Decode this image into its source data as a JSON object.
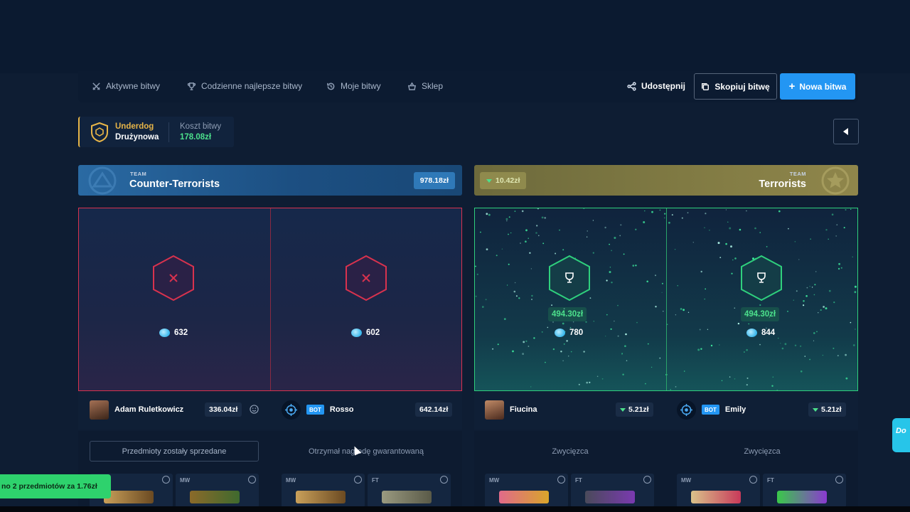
{
  "nav": {
    "items": [
      {
        "label": "Aktywne bitwy",
        "icon": "crossed-swords-icon"
      },
      {
        "label": "Codzienne najlepsze bitwy",
        "icon": "trophy-icon"
      },
      {
        "label": "Moje bitwy",
        "icon": "history-icon"
      },
      {
        "label": "Sklep",
        "icon": "basket-icon"
      }
    ],
    "share": "Udostępnij",
    "copy": "Skopiuj bitwę",
    "new": "Nowa bitwa"
  },
  "battle_info": {
    "mode": "Underdog",
    "type": "Drużynowa",
    "cost_label": "Koszt bitwy",
    "cost_value": "178.08zł"
  },
  "teams": {
    "ct": {
      "small": "TEAM",
      "name": "Counter-Terrorists",
      "value": "978.18zł"
    },
    "t": {
      "small": "TEAM",
      "name": "Terrorists",
      "value": "10.42zł"
    }
  },
  "slots": [
    {
      "result": "lose",
      "tickets": "632",
      "player": "Adam Ruletkowicz",
      "value": "336.04zł",
      "status": "Przedmioty zostały sprzedane"
    },
    {
      "result": "lose",
      "tickets": "602",
      "player": "Rosso",
      "bot": "BOT",
      "value": "642.14zł",
      "status": "Otrzymał nagrodę gwarantowaną"
    },
    {
      "result": "win",
      "win_amount": "494.30zł",
      "tickets": "780",
      "player": "Fiucina",
      "value": "5.21zł",
      "status": "Zwycięzca"
    },
    {
      "result": "win",
      "win_amount": "494.30zł",
      "tickets": "844",
      "player": "Emily",
      "bot": "BOT",
      "value": "5.21zł",
      "status": "Zwycięzca"
    }
  ],
  "cards": [
    {
      "grade": ""
    },
    {
      "grade": "MW"
    },
    {
      "grade": "MW"
    },
    {
      "grade": "FT"
    },
    {
      "grade": "MW"
    },
    {
      "grade": "FT"
    },
    {
      "grade": "MW"
    },
    {
      "grade": "FT"
    }
  ],
  "toast": "no 2 przedmiotów za 1.76zł",
  "side_pill": "Do",
  "colors": {
    "accent": "#2396f3",
    "win": "#4ce08c",
    "lose": "#d8324e",
    "gold": "#e7b548"
  }
}
